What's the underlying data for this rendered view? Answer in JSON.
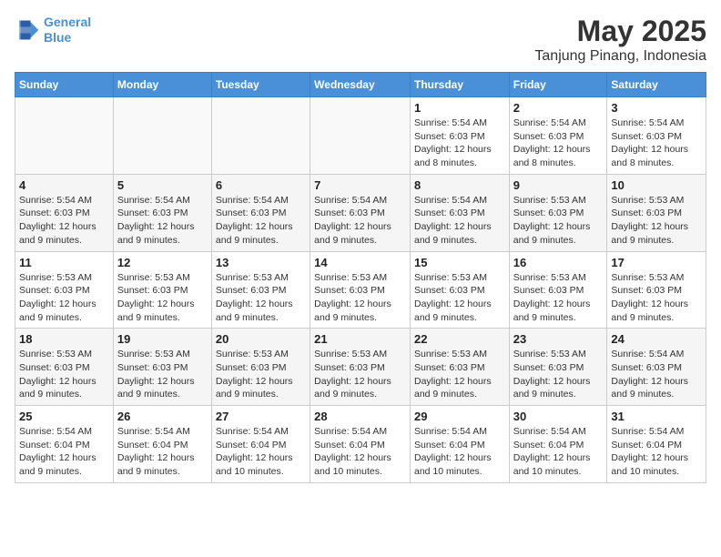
{
  "header": {
    "logo_line1": "General",
    "logo_line2": "Blue",
    "title": "May 2025",
    "subtitle": "Tanjung Pinang, Indonesia"
  },
  "weekdays": [
    "Sunday",
    "Monday",
    "Tuesday",
    "Wednesday",
    "Thursday",
    "Friday",
    "Saturday"
  ],
  "weeks": [
    [
      {
        "day": "",
        "info": ""
      },
      {
        "day": "",
        "info": ""
      },
      {
        "day": "",
        "info": ""
      },
      {
        "day": "",
        "info": ""
      },
      {
        "day": "1",
        "info": "Sunrise: 5:54 AM\nSunset: 6:03 PM\nDaylight: 12 hours\nand 8 minutes."
      },
      {
        "day": "2",
        "info": "Sunrise: 5:54 AM\nSunset: 6:03 PM\nDaylight: 12 hours\nand 8 minutes."
      },
      {
        "day": "3",
        "info": "Sunrise: 5:54 AM\nSunset: 6:03 PM\nDaylight: 12 hours\nand 8 minutes."
      }
    ],
    [
      {
        "day": "4",
        "info": "Sunrise: 5:54 AM\nSunset: 6:03 PM\nDaylight: 12 hours\nand 9 minutes."
      },
      {
        "day": "5",
        "info": "Sunrise: 5:54 AM\nSunset: 6:03 PM\nDaylight: 12 hours\nand 9 minutes."
      },
      {
        "day": "6",
        "info": "Sunrise: 5:54 AM\nSunset: 6:03 PM\nDaylight: 12 hours\nand 9 minutes."
      },
      {
        "day": "7",
        "info": "Sunrise: 5:54 AM\nSunset: 6:03 PM\nDaylight: 12 hours\nand 9 minutes."
      },
      {
        "day": "8",
        "info": "Sunrise: 5:54 AM\nSunset: 6:03 PM\nDaylight: 12 hours\nand 9 minutes."
      },
      {
        "day": "9",
        "info": "Sunrise: 5:53 AM\nSunset: 6:03 PM\nDaylight: 12 hours\nand 9 minutes."
      },
      {
        "day": "10",
        "info": "Sunrise: 5:53 AM\nSunset: 6:03 PM\nDaylight: 12 hours\nand 9 minutes."
      }
    ],
    [
      {
        "day": "11",
        "info": "Sunrise: 5:53 AM\nSunset: 6:03 PM\nDaylight: 12 hours\nand 9 minutes."
      },
      {
        "day": "12",
        "info": "Sunrise: 5:53 AM\nSunset: 6:03 PM\nDaylight: 12 hours\nand 9 minutes."
      },
      {
        "day": "13",
        "info": "Sunrise: 5:53 AM\nSunset: 6:03 PM\nDaylight: 12 hours\nand 9 minutes."
      },
      {
        "day": "14",
        "info": "Sunrise: 5:53 AM\nSunset: 6:03 PM\nDaylight: 12 hours\nand 9 minutes."
      },
      {
        "day": "15",
        "info": "Sunrise: 5:53 AM\nSunset: 6:03 PM\nDaylight: 12 hours\nand 9 minutes."
      },
      {
        "day": "16",
        "info": "Sunrise: 5:53 AM\nSunset: 6:03 PM\nDaylight: 12 hours\nand 9 minutes."
      },
      {
        "day": "17",
        "info": "Sunrise: 5:53 AM\nSunset: 6:03 PM\nDaylight: 12 hours\nand 9 minutes."
      }
    ],
    [
      {
        "day": "18",
        "info": "Sunrise: 5:53 AM\nSunset: 6:03 PM\nDaylight: 12 hours\nand 9 minutes."
      },
      {
        "day": "19",
        "info": "Sunrise: 5:53 AM\nSunset: 6:03 PM\nDaylight: 12 hours\nand 9 minutes."
      },
      {
        "day": "20",
        "info": "Sunrise: 5:53 AM\nSunset: 6:03 PM\nDaylight: 12 hours\nand 9 minutes."
      },
      {
        "day": "21",
        "info": "Sunrise: 5:53 AM\nSunset: 6:03 PM\nDaylight: 12 hours\nand 9 minutes."
      },
      {
        "day": "22",
        "info": "Sunrise: 5:53 AM\nSunset: 6:03 PM\nDaylight: 12 hours\nand 9 minutes."
      },
      {
        "day": "23",
        "info": "Sunrise: 5:53 AM\nSunset: 6:03 PM\nDaylight: 12 hours\nand 9 minutes."
      },
      {
        "day": "24",
        "info": "Sunrise: 5:54 AM\nSunset: 6:03 PM\nDaylight: 12 hours\nand 9 minutes."
      }
    ],
    [
      {
        "day": "25",
        "info": "Sunrise: 5:54 AM\nSunset: 6:04 PM\nDaylight: 12 hours\nand 9 minutes."
      },
      {
        "day": "26",
        "info": "Sunrise: 5:54 AM\nSunset: 6:04 PM\nDaylight: 12 hours\nand 9 minutes."
      },
      {
        "day": "27",
        "info": "Sunrise: 5:54 AM\nSunset: 6:04 PM\nDaylight: 12 hours\nand 10 minutes."
      },
      {
        "day": "28",
        "info": "Sunrise: 5:54 AM\nSunset: 6:04 PM\nDaylight: 12 hours\nand 10 minutes."
      },
      {
        "day": "29",
        "info": "Sunrise: 5:54 AM\nSunset: 6:04 PM\nDaylight: 12 hours\nand 10 minutes."
      },
      {
        "day": "30",
        "info": "Sunrise: 5:54 AM\nSunset: 6:04 PM\nDaylight: 12 hours\nand 10 minutes."
      },
      {
        "day": "31",
        "info": "Sunrise: 5:54 AM\nSunset: 6:04 PM\nDaylight: 12 hours\nand 10 minutes."
      }
    ]
  ]
}
